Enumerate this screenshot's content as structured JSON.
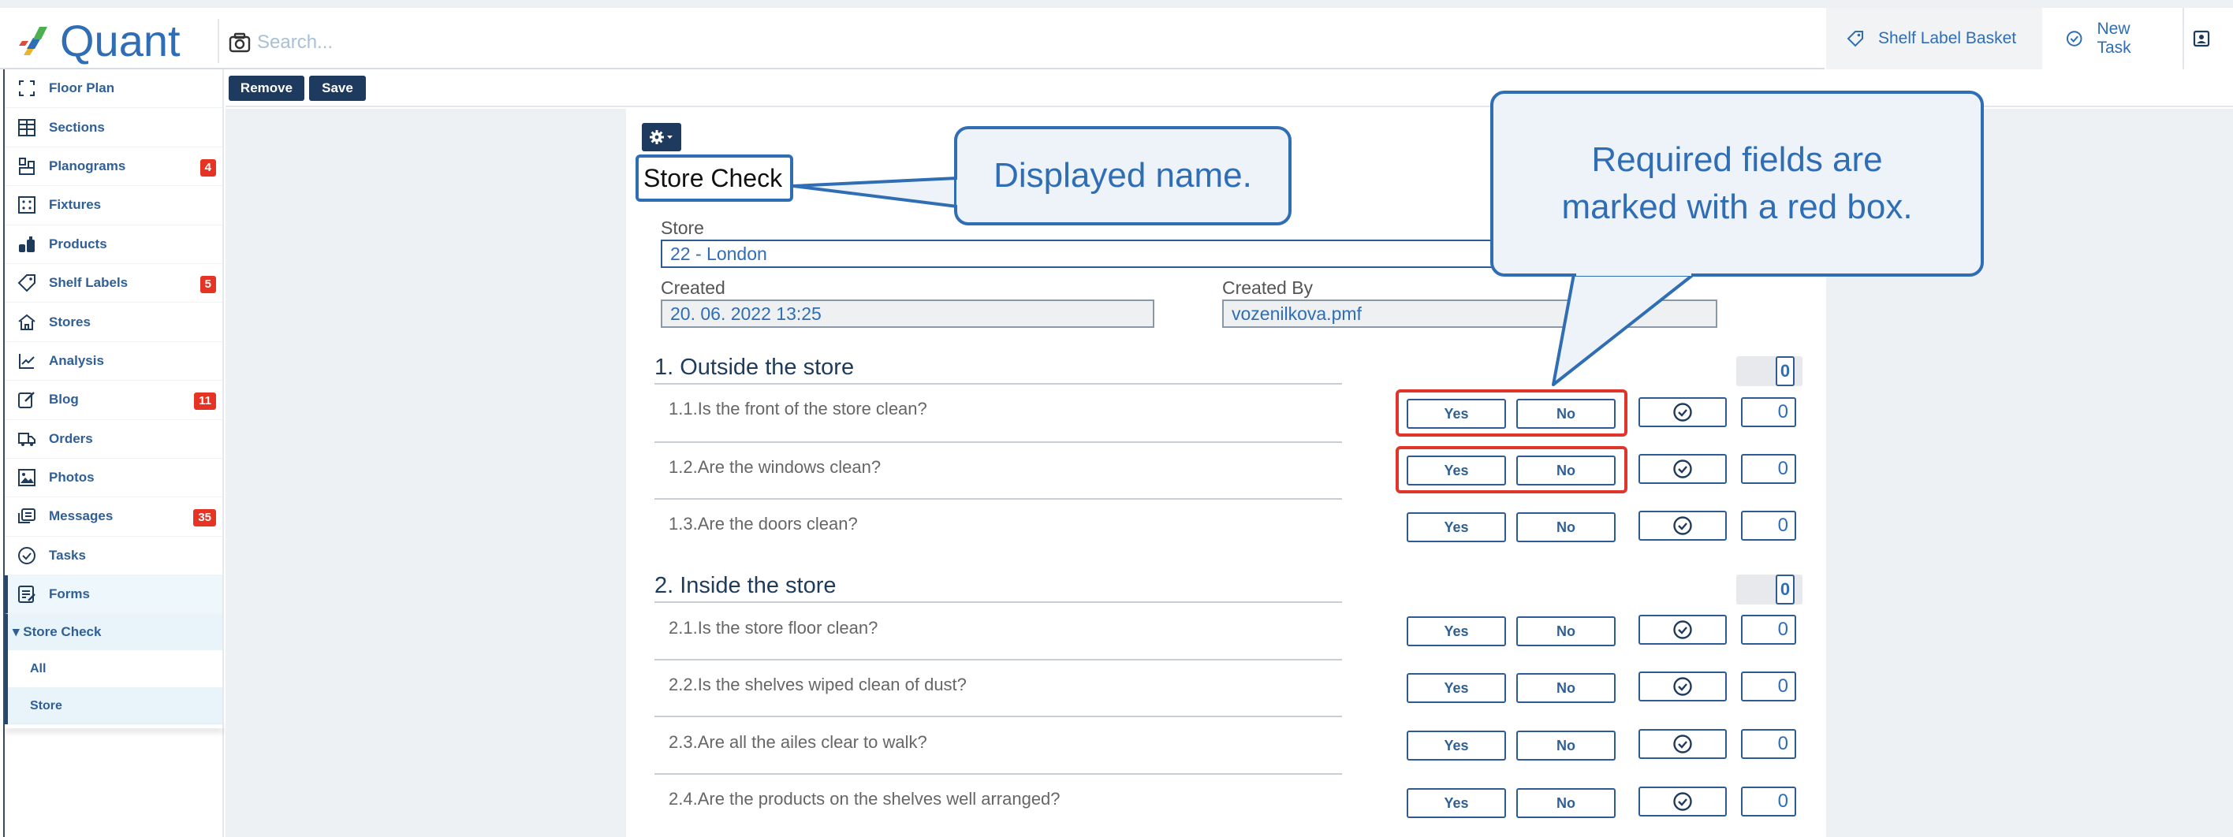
{
  "app": {
    "logo_text": "Quant",
    "search_placeholder": "Search...",
    "shelf_label_basket": "Shelf Label Basket",
    "new_task": "New Task"
  },
  "sidebar": {
    "items": [
      {
        "label": "Floor Plan",
        "icon": "floor-plan-icon"
      },
      {
        "label": "Sections",
        "icon": "sections-icon"
      },
      {
        "label": "Planograms",
        "icon": "planograms-icon",
        "badge": "4"
      },
      {
        "label": "Fixtures",
        "icon": "fixtures-icon"
      },
      {
        "label": "Products",
        "icon": "products-icon"
      },
      {
        "label": "Shelf Labels",
        "icon": "tag-icon",
        "badge": "5"
      },
      {
        "label": "Stores",
        "icon": "store-icon"
      },
      {
        "label": "Analysis",
        "icon": "analysis-icon"
      },
      {
        "label": "Blog",
        "icon": "blog-icon",
        "badge": "11"
      },
      {
        "label": "Orders",
        "icon": "truck-icon"
      },
      {
        "label": "Photos",
        "icon": "photo-icon"
      },
      {
        "label": "Messages",
        "icon": "messages-icon",
        "badge": "35"
      },
      {
        "label": "Tasks",
        "icon": "check-circle-icon"
      },
      {
        "label": "Forms",
        "icon": "forms-icon"
      }
    ],
    "sub_head": "▾ Store Check",
    "sub_items": [
      "All",
      "Store"
    ]
  },
  "toolbar": {
    "remove": "Remove",
    "save": "Save"
  },
  "form": {
    "title": "Store Check",
    "store_label": "Store",
    "store_value": "22 - London",
    "created_label": "Created",
    "created_value": "20. 06. 2022 13:25",
    "created_by_label": "Created By",
    "created_by_value": "vozenilkova.pmf",
    "yes": "Yes",
    "no": "No",
    "sections": [
      {
        "title": "1. Outside the store",
        "score": "0",
        "questions": [
          {
            "text": "1.1.Is the front of the store clean?",
            "value": "0"
          },
          {
            "text": "1.2.Are the windows clean?",
            "value": "0"
          },
          {
            "text": "1.3.Are the doors clean?",
            "value": "0"
          }
        ]
      },
      {
        "title": "2. Inside the store",
        "score": "0",
        "questions": [
          {
            "text": "2.1.Is the store floor clean?",
            "value": "0"
          },
          {
            "text": "2.2.Is the shelves wiped clean of dust?",
            "value": "0"
          },
          {
            "text": "2.3.Are all the ailes clear to walk?",
            "value": "0"
          },
          {
            "text": "2.4.Are the products on the shelves well arranged?",
            "value": "0"
          }
        ]
      }
    ]
  },
  "callouts": {
    "displayed_name": "Displayed name.",
    "required_line1": "Required fields are",
    "required_line2": "marked with a red box."
  },
  "colors": {
    "brand_blue": "#2f6db5",
    "dark_navy": "#1f3a5f",
    "badge_red": "#e53424",
    "required_red": "#e0352b"
  }
}
